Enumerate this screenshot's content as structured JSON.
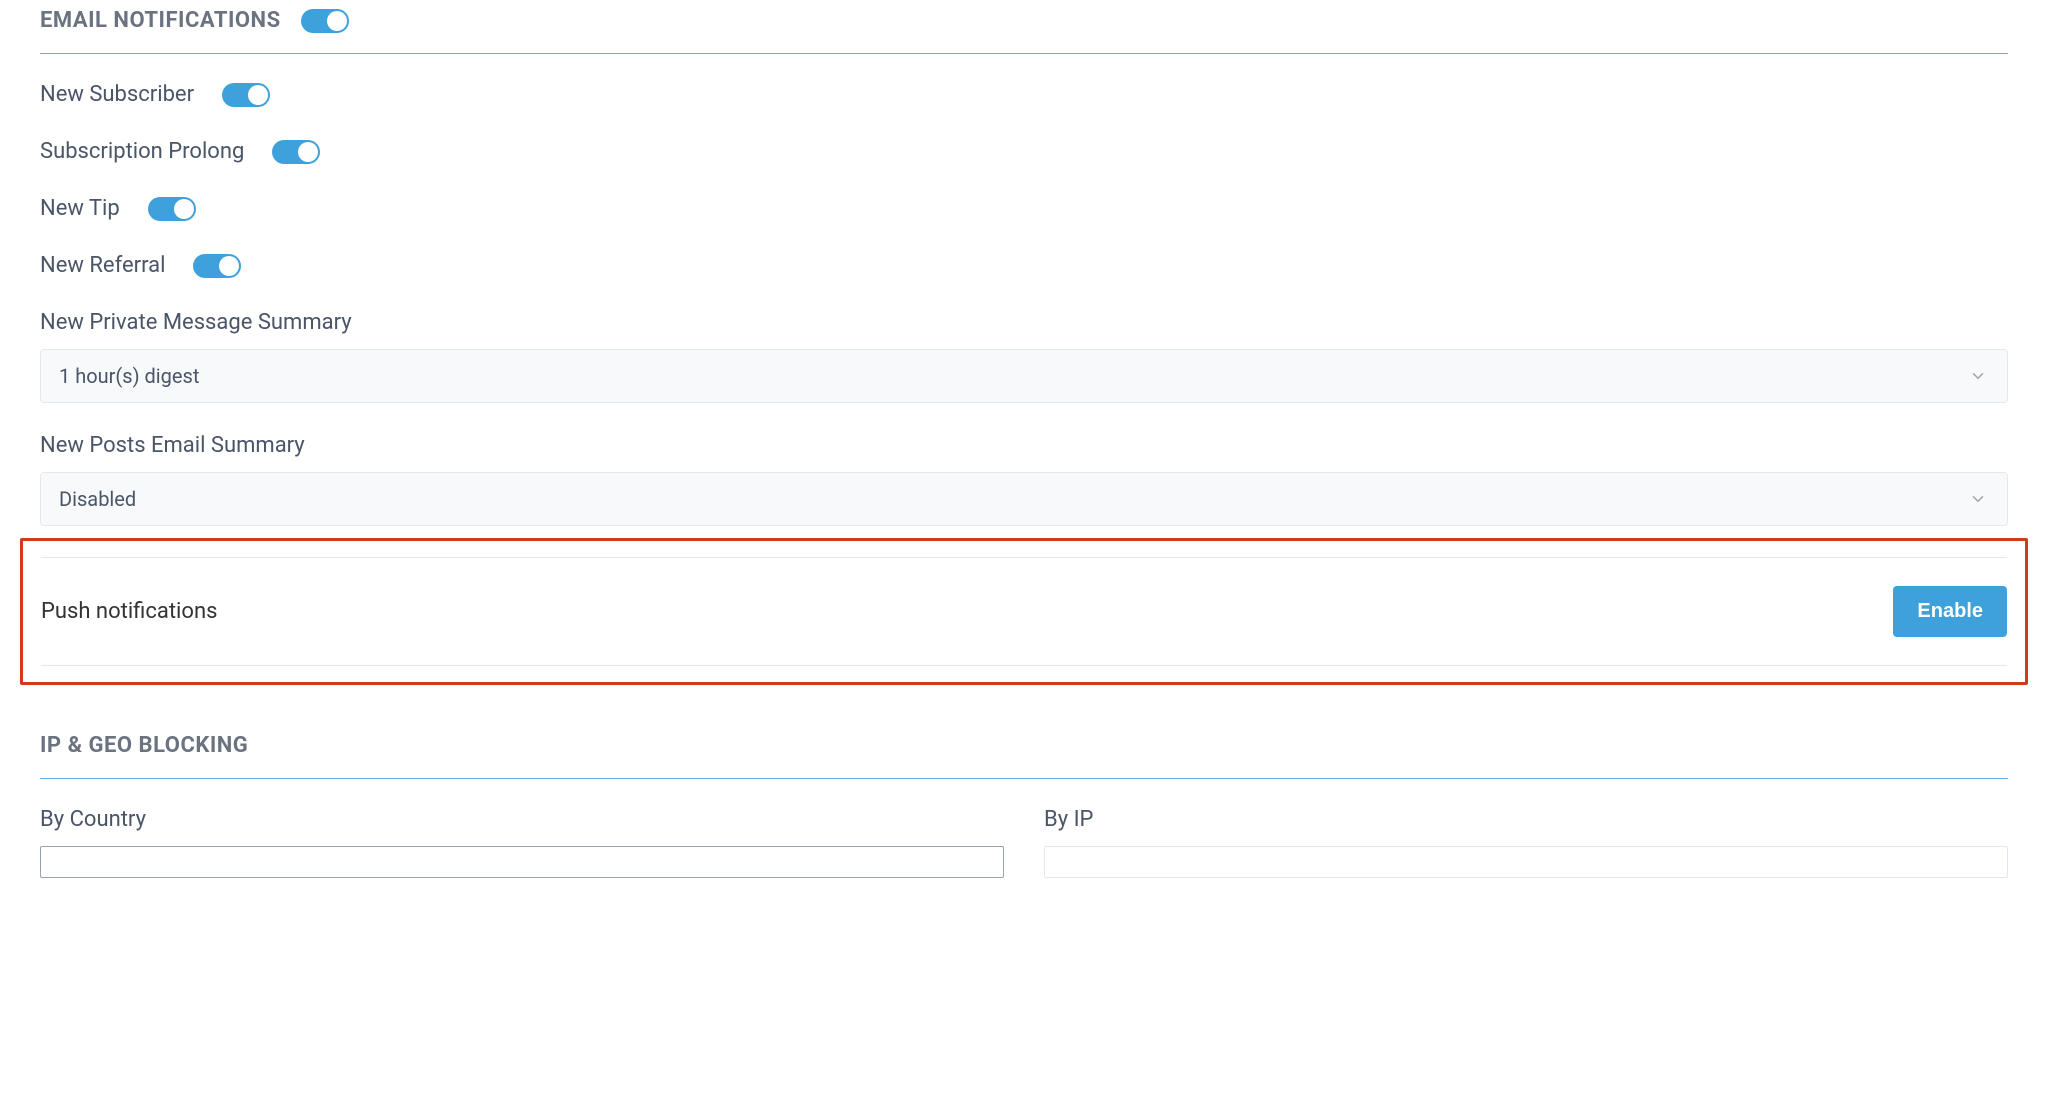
{
  "emailNotifications": {
    "title": "EMAIL NOTIFICATIONS",
    "items": {
      "newSubscriber": "New Subscriber",
      "subscriptionProlong": "Subscription Prolong",
      "newTip": "New Tip",
      "newReferral": "New Referral"
    },
    "privateMsg": {
      "label": "New Private Message Summary",
      "value": "1 hour(s) digest"
    },
    "postsSummary": {
      "label": "New Posts Email Summary",
      "value": "Disabled"
    }
  },
  "push": {
    "label": "Push notifications",
    "button": "Enable"
  },
  "geo": {
    "title": "IP & GEO BLOCKING",
    "byCountry": "By Country",
    "byIp": "By IP"
  }
}
